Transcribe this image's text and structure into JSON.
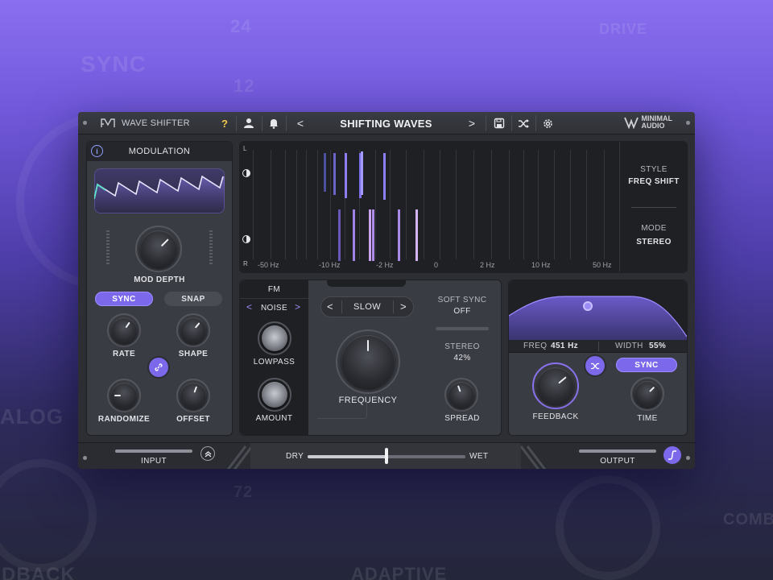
{
  "background": {
    "words": [
      "SYNC",
      "DRIVE",
      "ALOG",
      "DBACK",
      "ADAPTIVE",
      "COMB"
    ],
    "numbers": [
      "24",
      "12",
      "72"
    ]
  },
  "topbar": {
    "plugin_name": "WAVE SHIFTER",
    "help_label": "?",
    "preset_name": "SHIFTING WAVES",
    "prev_label": "<",
    "next_label": ">",
    "brand_line1": "MINIMAL",
    "brand_line2": "AUDIO"
  },
  "modulation": {
    "title": "MODULATION",
    "info_label": "i",
    "mod_depth_label": "MOD DEPTH",
    "sync_label": "SYNC",
    "snap_label": "SNAP",
    "rate_label": "RATE",
    "shape_label": "SHAPE",
    "randomize_label": "RANDOMIZE",
    "offset_label": "OFFSET"
  },
  "spectrum": {
    "channel_left": "L",
    "channel_right": "R",
    "hz_labels": [
      "-50 Hz",
      "-10 Hz",
      "-2 Hz",
      "0",
      "2 Hz",
      "10 Hz",
      "50 Hz"
    ],
    "style_title": "STYLE",
    "style_value": "FREQ SHIFT",
    "mode_title": "MODE",
    "mode_value": "STEREO"
  },
  "fm": {
    "title": "FM",
    "type_value": "NOISE",
    "lowpass_label": "LOWPASS",
    "amount_label": "AMOUNT"
  },
  "center": {
    "speed_value": "SLOW",
    "frequency_label": "FREQUENCY",
    "soft_sync_title": "SOFT SYNC",
    "soft_sync_value": "OFF",
    "stereo_title": "STEREO",
    "stereo_value": "42%",
    "spread_label": "SPREAD"
  },
  "delay": {
    "freq_title": "FREQ",
    "freq_value": "451 Hz",
    "width_title": "WIDTH",
    "width_value": "55%",
    "sync_label": "SYNC",
    "feedback_label": "FEEDBACK",
    "time_label": "TIME"
  },
  "bottom": {
    "input_label": "INPUT",
    "dry_label": "DRY",
    "wet_label": "WET",
    "output_label": "OUTPUT",
    "dry_wet_value": 0.5
  },
  "colors": {
    "accent": "#7b68ea",
    "panel": "#3a3c43",
    "dark": "#1f2024"
  }
}
